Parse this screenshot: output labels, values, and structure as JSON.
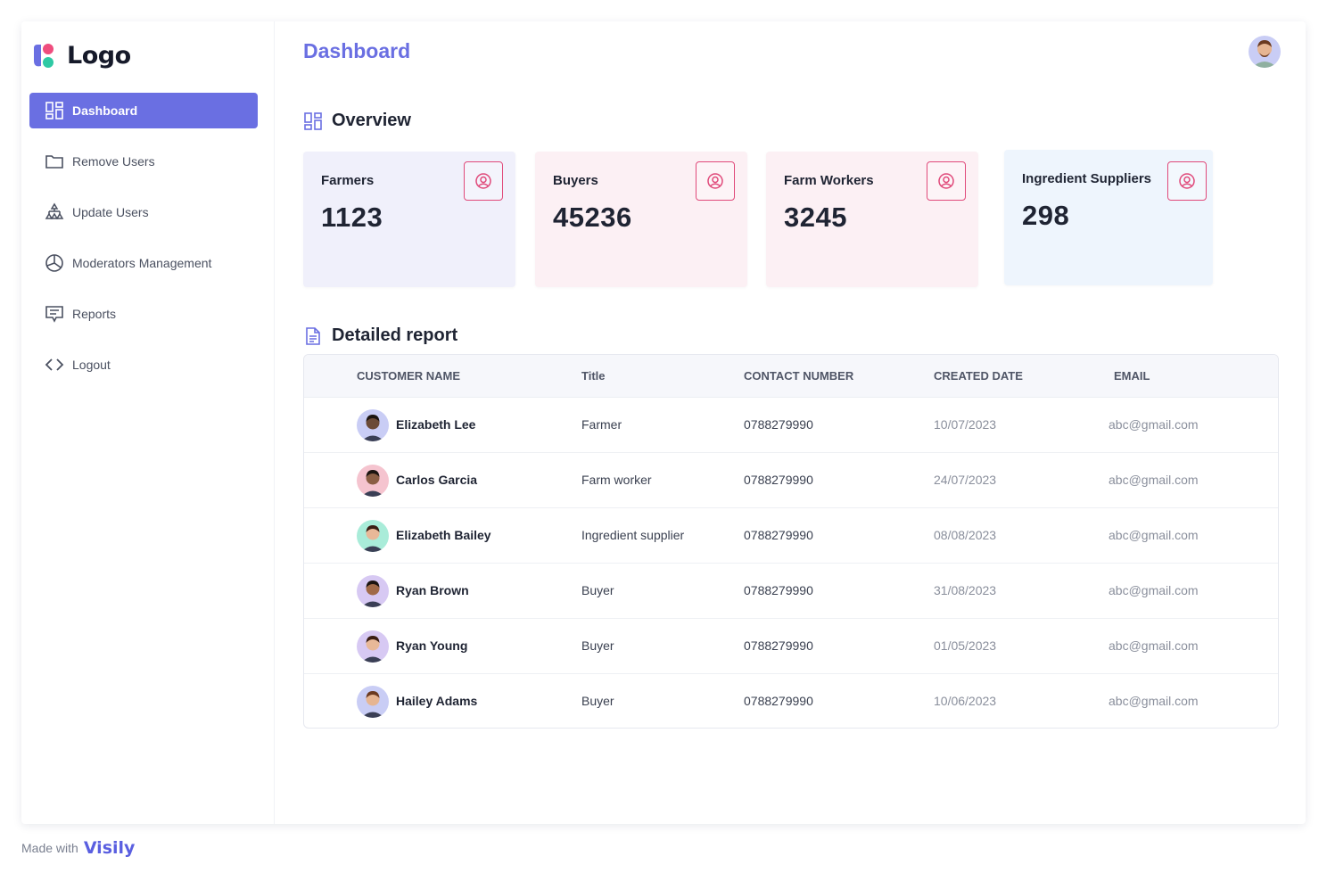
{
  "brand": {
    "logo_text": "Logo"
  },
  "sidebar": {
    "items": [
      {
        "label": "Dashboard",
        "icon": "dashboard-icon",
        "active": true
      },
      {
        "label": "Remove Users",
        "icon": "folder-icon"
      },
      {
        "label": "Update Users",
        "icon": "hierarchy-icon"
      },
      {
        "label": "Moderators Management",
        "icon": "pie-chart-icon"
      },
      {
        "label": "Reports",
        "icon": "message-icon"
      },
      {
        "label": "Logout",
        "icon": "code-icon"
      }
    ]
  },
  "header": {
    "title": "Dashboard"
  },
  "overview": {
    "title": "Overview",
    "cards": [
      {
        "label": "Farmers",
        "value": "1123",
        "bg": "#f0f0fb"
      },
      {
        "label": "Buyers",
        "value": "45236",
        "bg": "#fcf0f4"
      },
      {
        "label": "Farm Workers",
        "value": "3245",
        "bg": "#fcf0f4"
      },
      {
        "label": "Ingredient Suppliers",
        "value": "298",
        "bg": "#eef5fd"
      }
    ]
  },
  "report": {
    "title": "Detailed report",
    "columns": [
      "CUSTOMER NAME",
      "Title",
      "CONTACT NUMBER",
      "CREATED DATE",
      "EMAIL"
    ],
    "rows": [
      {
        "name": "Elizabeth Lee",
        "title": "Farmer",
        "phone": "0788279990",
        "date": "10/07/2023",
        "email": "abc@gmail.com",
        "avatar_bg": "#c9cdf5",
        "skin": "#6b4a36",
        "hair": "#1b1410"
      },
      {
        "name": "Carlos Garcia",
        "title": "Farm worker",
        "phone": "0788279990",
        "date": "24/07/2023",
        "email": "abc@gmail.com",
        "avatar_bg": "#f5c4cf",
        "skin": "#8a5e44",
        "hair": "#1b1410"
      },
      {
        "name": "Elizabeth Bailey",
        "title": "Ingredient supplier",
        "phone": "0788279990",
        "date": "08/08/2023",
        "email": "abc@gmail.com",
        "avatar_bg": "#a9ecd9",
        "skin": "#e8b898",
        "hair": "#3a1e14"
      },
      {
        "name": "Ryan Brown",
        "title": "Buyer",
        "phone": "0788279990",
        "date": "31/08/2023",
        "email": "abc@gmail.com",
        "avatar_bg": "#d7c9f3",
        "skin": "#a06a48",
        "hair": "#1b1410"
      },
      {
        "name": "Ryan Young",
        "title": "Buyer",
        "phone": "0788279990",
        "date": "01/05/2023",
        "email": "abc@gmail.com",
        "avatar_bg": "#d7c9f3",
        "skin": "#e8b898",
        "hair": "#3a1e14"
      },
      {
        "name": "Hailey Adams",
        "title": "Buyer",
        "phone": "0788279990",
        "date": "10/06/2023",
        "email": "abc@gmail.com",
        "avatar_bg": "#c9cdf5",
        "skin": "#e6b592",
        "hair": "#6b3a20"
      }
    ]
  },
  "footer": {
    "made_with": "Made with",
    "brand": "Visily"
  },
  "colors": {
    "accent": "#6a6fe2",
    "pink_accent": "#e0497a"
  }
}
